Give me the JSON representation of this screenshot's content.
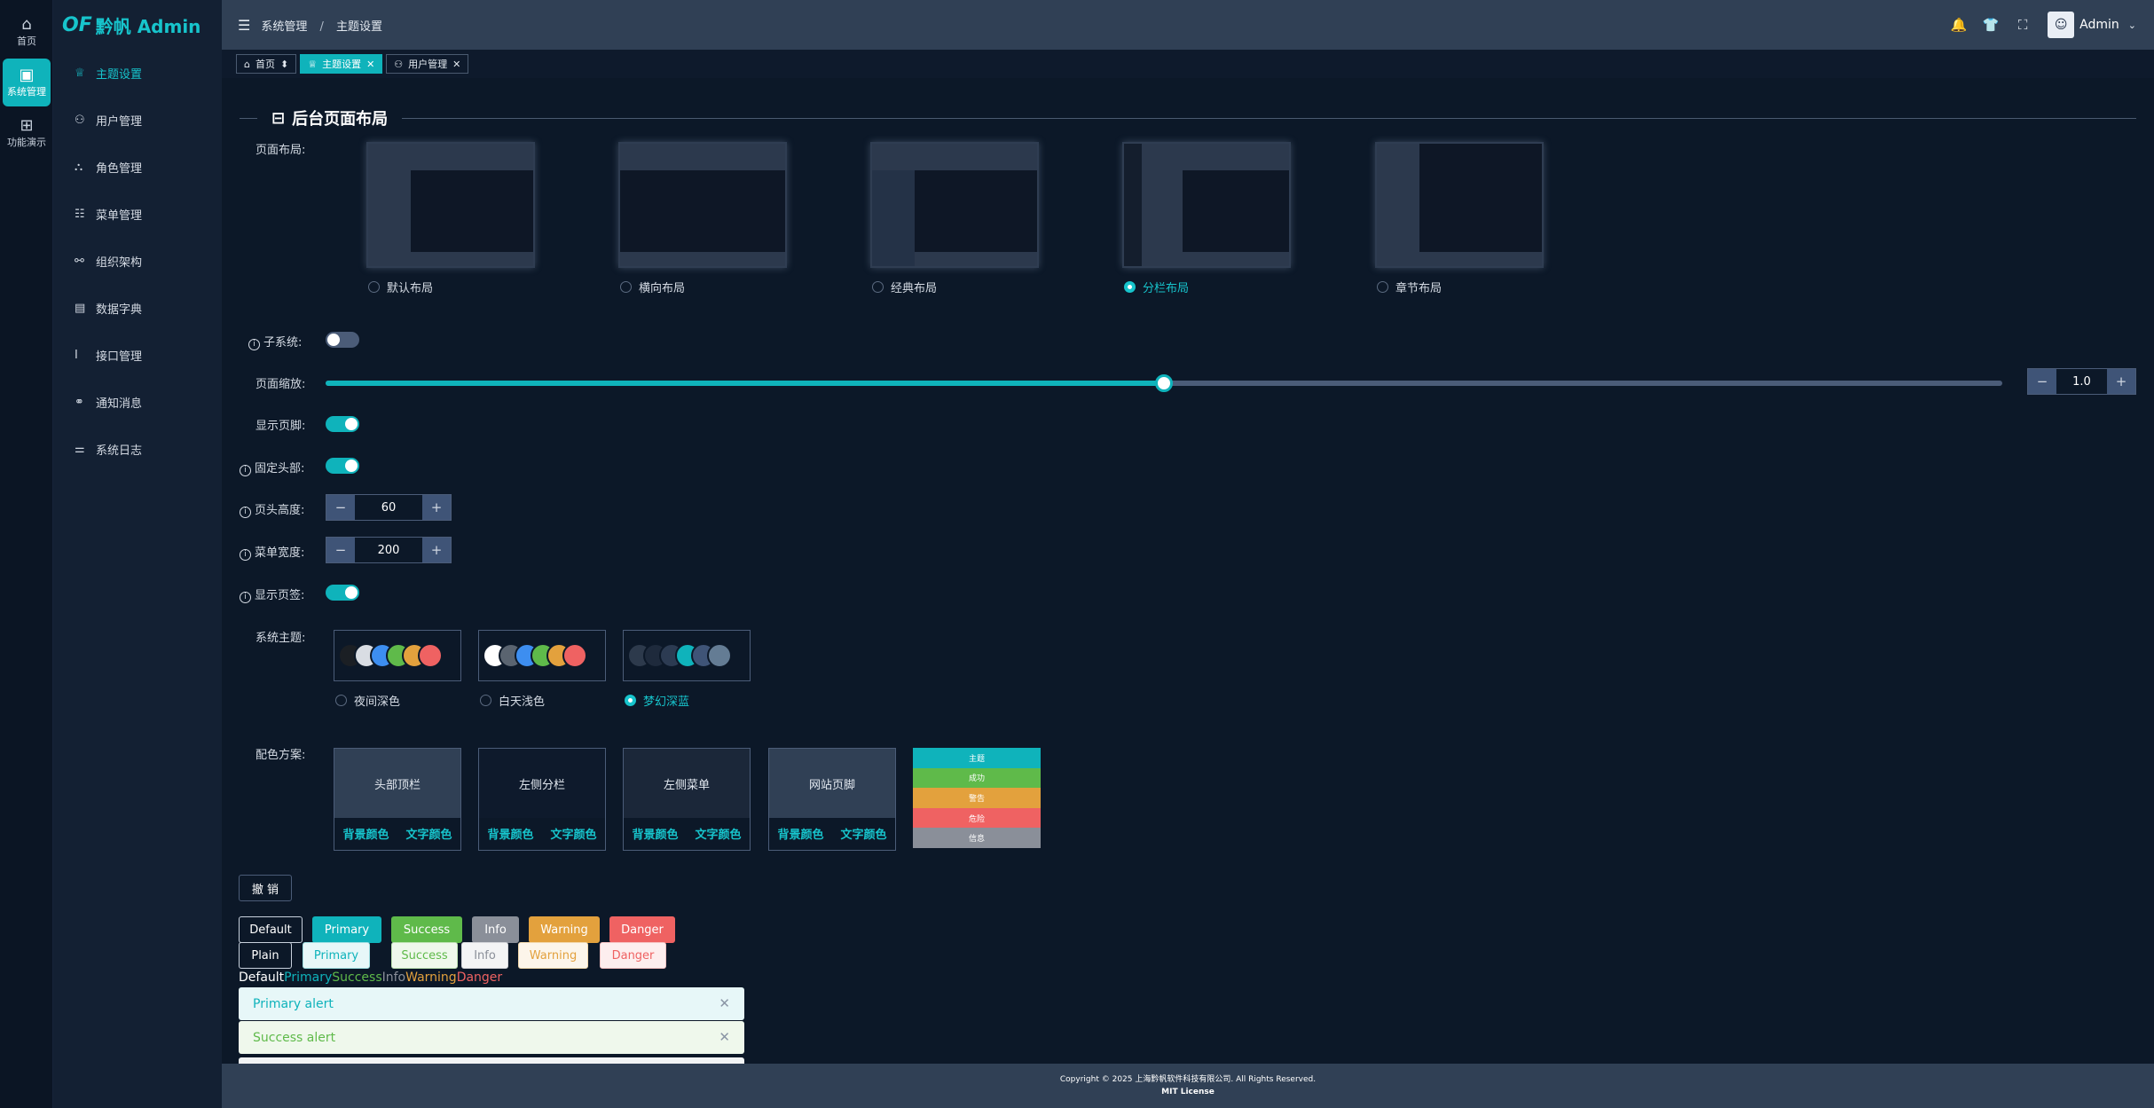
{
  "rail": [
    {
      "icon": "home-icon",
      "glyph": "⌂",
      "label": "首页"
    },
    {
      "icon": "system-icon",
      "glyph": "▣",
      "label": "系统管理",
      "active": true
    },
    {
      "icon": "apps-icon",
      "glyph": "⊞",
      "label": "功能演示"
    }
  ],
  "logo": {
    "mark": "OF",
    "text": "黔帆 Admin"
  },
  "menu": [
    {
      "glyph": "♕",
      "label": "主题设置",
      "active": true
    },
    {
      "glyph": "⚇",
      "label": "用户管理"
    },
    {
      "glyph": "⛬",
      "label": "角色管理"
    },
    {
      "glyph": "☷",
      "label": "菜单管理"
    },
    {
      "glyph": "⚯",
      "label": "组织架构"
    },
    {
      "glyph": "▤",
      "label": "数据字典"
    },
    {
      "glyph": "I",
      "label": "接口管理"
    },
    {
      "glyph": "⚭",
      "label": "通知消息"
    },
    {
      "glyph": "⚌",
      "label": "系统日志"
    }
  ],
  "header": {
    "fold_glyph": "☰",
    "breadcrumb": [
      "系统管理",
      "主题设置"
    ],
    "sep": "/",
    "icons": [
      {
        "name": "bell-icon",
        "glyph": "🔔"
      },
      {
        "name": "shirt-icon",
        "glyph": "👕"
      },
      {
        "name": "fullscreen-icon",
        "glyph": "⛶"
      }
    ],
    "avatar_glyph": "☺",
    "user": "Admin",
    "caret": "⌄"
  },
  "tabs": [
    {
      "icon": "⌂",
      "label": "首页",
      "suffix": "⬍"
    },
    {
      "icon": "♕",
      "label": "主题设置",
      "suffix": "✕",
      "active": true
    },
    {
      "icon": "⚇",
      "label": "用户管理",
      "suffix": "✕"
    }
  ],
  "section": {
    "title": "后台页面布局",
    "icon": "⊟"
  },
  "labels": {
    "page_layout": "页面布局:",
    "subsystem": "子系统:",
    "zoom": "页面缩放:",
    "show_footer": "显示页脚:",
    "fixed_header": "固定头部:",
    "header_height": "页头高度:",
    "menu_width": "菜单宽度:",
    "show_tabs": "显示页签:",
    "system_theme": "系统主题:",
    "color_scheme": "配色方案:",
    "info": "i"
  },
  "layouts": [
    {
      "label": "默认布局",
      "selected": false
    },
    {
      "label": "横向布局",
      "selected": false
    },
    {
      "label": "经典布局",
      "selected": false
    },
    {
      "label": "分栏布局",
      "selected": true
    },
    {
      "label": "章节布局",
      "selected": false
    }
  ],
  "settings": {
    "subsystem": false,
    "zoom_fraction": 0.5,
    "zoom_value": "1.0",
    "show_footer": true,
    "fixed_header": true,
    "header_height": "60",
    "menu_width": "200",
    "show_tabs": true,
    "minus": "−",
    "plus": "+"
  },
  "themes": [
    {
      "label": "夜间深色",
      "selected": false,
      "colors": [
        "#1b1f24",
        "#d9dde3",
        "#3d8ef0",
        "#5fba4a",
        "#e3a13d",
        "#ef6262"
      ]
    },
    {
      "label": "白天浅色",
      "selected": false,
      "colors": [
        "#ffffff",
        "#5a6470",
        "#3d8ef0",
        "#5fba4a",
        "#e3a13d",
        "#ef6262"
      ]
    },
    {
      "label": "梦幻深蓝",
      "selected": true,
      "colors": [
        "#2d3a4c",
        "#1e2a3c",
        "#2c3b52",
        "#0fb3bb",
        "#3f5477",
        "#647c94"
      ]
    }
  ],
  "schemes": [
    {
      "title": "头部顶栏",
      "bg": "#304055",
      "bg_label": "背景颜色",
      "text_label": "文字颜色"
    },
    {
      "title": "左侧分栏",
      "bg": "#0e1a2c",
      "bg_label": "背景颜色",
      "text_label": "文字颜色"
    },
    {
      "title": "左侧菜单",
      "bg": "#1b2739",
      "bg_label": "背景颜色",
      "text_label": "文字颜色"
    },
    {
      "title": "网站页脚",
      "bg": "#304055",
      "bg_label": "背景颜色",
      "text_label": "文字颜色"
    }
  ],
  "palette": [
    {
      "label": "主题",
      "color": "#0fb3bb"
    },
    {
      "label": "成功",
      "color": "#5fba4a"
    },
    {
      "label": "警告",
      "color": "#e3a13d"
    },
    {
      "label": "危险",
      "color": "#ef6262"
    },
    {
      "label": "信息",
      "color": "#8a8f99"
    }
  ],
  "undo_label": "撤 销",
  "buttons_solid": [
    "Default",
    "Primary",
    "Success",
    "Info",
    "Warning",
    "Danger"
  ],
  "buttons_plain": [
    "Plain",
    "Primary",
    "Success",
    "Info",
    "Warning",
    "Danger"
  ],
  "text_samples": [
    "Default",
    "Primary",
    "Success",
    "Info",
    "Warning",
    "Danger"
  ],
  "alerts": [
    {
      "text": "Primary alert",
      "close": "✕"
    },
    {
      "text": "Success alert",
      "close": "✕"
    }
  ],
  "footer": {
    "line1": "Copyright © 2025 上海黔帆软件科技有限公司. All Rights Reserved.",
    "line2": "MIT License"
  },
  "colors": {
    "accent": "#0fb3bb",
    "success": "#5fba4a",
    "info": "#8a8f99",
    "warning": "#e3a13d",
    "danger": "#ef6262"
  }
}
